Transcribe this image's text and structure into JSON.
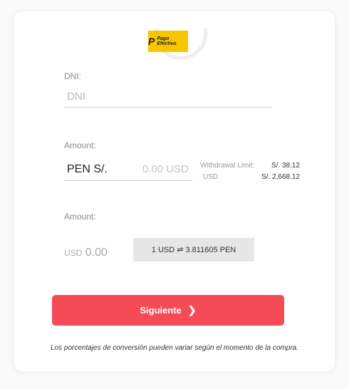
{
  "logo": {
    "letter": "P",
    "text": "Pago Efectivo"
  },
  "dni": {
    "label": "DNI:",
    "placeholder": "DNI"
  },
  "amount_pen": {
    "label": "Amount:",
    "currency": "PEN S/.",
    "placeholder": "0.00 USD"
  },
  "withdrawal": {
    "label": "Withdrawal Limit:",
    "pen_value": "S/. 38.12",
    "usd_label": "USD",
    "usd_value": "S/. 2,668.12"
  },
  "amount_usd": {
    "label": "Amount:",
    "currency": "USD",
    "value": "0.00"
  },
  "rate": {
    "text": "1 USD ⇌ 3.811605 PEN"
  },
  "submit": {
    "label": "Siguiente",
    "icon": "chevron-right-icon"
  },
  "note": "Los porcentajes de conversión pueden variar según el momento de la compra.",
  "colors": {
    "accent": "#f44b57",
    "logo_bg": "#f7c600"
  }
}
